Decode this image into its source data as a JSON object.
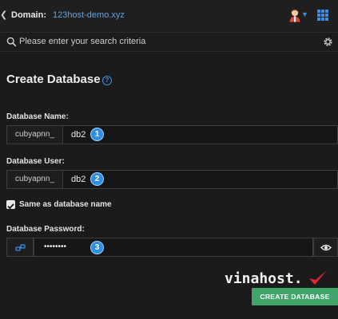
{
  "header": {
    "domain_label": "Domain:",
    "domain_value": "123host-demo.xyz",
    "icons": [
      "back-chevron-icon",
      "user-avatar-icon",
      "caret-down-icon",
      "apps-grid-icon"
    ]
  },
  "search": {
    "placeholder": "Please enter your search criteria",
    "icons": [
      "search-icon",
      "settings-gear-icon"
    ]
  },
  "page": {
    "title": "Create Database",
    "help_icon": "?"
  },
  "form": {
    "db_name": {
      "label": "Database Name:",
      "prefix": "cubyapnn_",
      "value": "db2",
      "badge": "1"
    },
    "db_user": {
      "label": "Database User:",
      "prefix": "cubyapnn_",
      "value": "db2",
      "badge": "2"
    },
    "same_as_name": {
      "label": "Same as database name",
      "checked": true
    },
    "db_password": {
      "label": "Database Password:",
      "value": "••••••••",
      "badge": "3",
      "icons": [
        "key-generate-icon",
        "eye-icon"
      ]
    }
  },
  "watermark": {
    "text": "vinahost."
  },
  "actions": {
    "create_label": "CREATE DATABASE"
  },
  "colors": {
    "background": "#1b1b1b",
    "accent_blue": "#3b8fe5",
    "badge_blue": "#2f8ee0",
    "button_green": "#41a56b",
    "watermark_red": "#e0282e"
  }
}
